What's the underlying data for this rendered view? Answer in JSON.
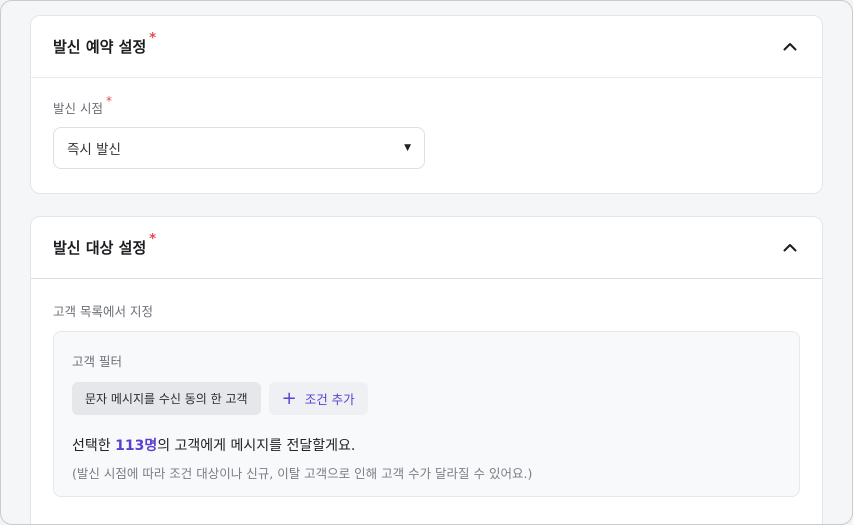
{
  "reservation": {
    "title": "발신 예약 설정",
    "required_mark": "*",
    "timing_label": "발신 시점",
    "timing_value": "즉시 발신"
  },
  "target": {
    "title": "발신 대상 설정",
    "required_mark": "*",
    "source_label": "고객 목록에서 지정",
    "filter_title": "고객 필터",
    "filter_chip": "문자 메시지를 수신 동의 한 고객",
    "add_condition": "조건 추가",
    "summary_prefix": "선택한 ",
    "summary_count": "113명",
    "summary_suffix": "의 고객에게 메시지를 전달할게요.",
    "note": "(발신 시점에 따라 조건 대상이나 신규, 이탈 고객으로 인해 고객 수가 달라질 수 있어요.)"
  },
  "icons": {
    "collapse": "chevron-up-icon",
    "dropdown": "caret-down-icon",
    "add": "plus-icon"
  },
  "colors": {
    "accent": "#5b3fd4",
    "required": "#e5484d"
  }
}
